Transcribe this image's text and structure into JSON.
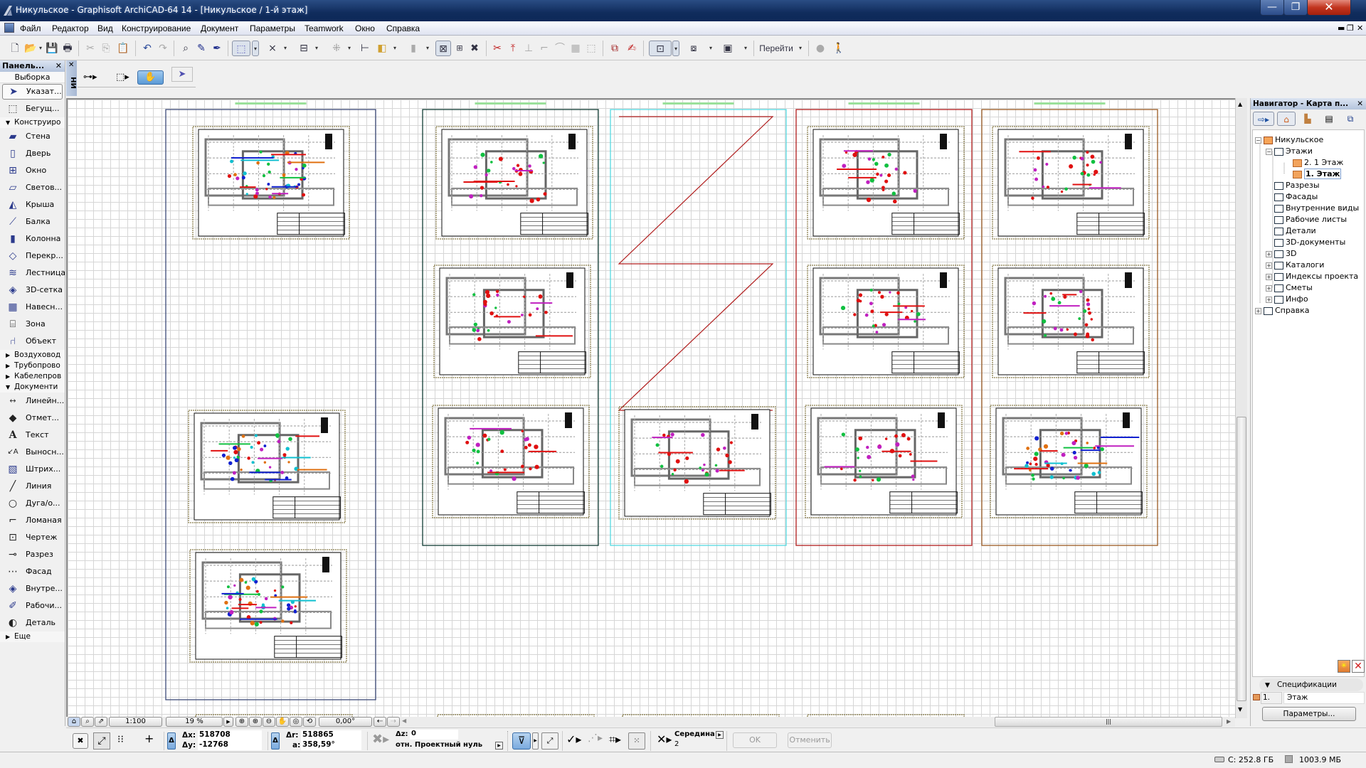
{
  "window": {
    "title": "Никульское - Graphisoft ArchiCAD-64 14 - [Никульское / 1-й этаж]",
    "controls": {
      "minimize": "—",
      "maximize": "❐",
      "close": "✕"
    }
  },
  "menubar": {
    "items": [
      "Файл",
      "Редактор",
      "Вид",
      "Конструирование",
      "Документ",
      "Параметры",
      "Teamwork",
      "Окно",
      "Справка"
    ],
    "mdi_controls": {
      "minimize": "▬",
      "restore": "❐",
      "close": "✕"
    }
  },
  "toolbar": {
    "goto_label": "Перейти",
    "icons": [
      "new-file",
      "open-file",
      "save",
      "print",
      "cut",
      "copy",
      "paste",
      "undo",
      "redo",
      "find-select",
      "eyedropper",
      "syringe",
      "marquee-select",
      "intersection",
      "element-info",
      "grid-snap",
      "ruler",
      "layers",
      "trace",
      "gravity",
      "dimension",
      "delete",
      "split",
      "adjust",
      "trim",
      "fillet",
      "curve",
      "group",
      "ungroup",
      "fit-in-window",
      "pen-set",
      "floorplan-view",
      "3d-view",
      "layout-view",
      "navigator",
      "walk"
    ]
  },
  "toolbox": {
    "title": "Панель...",
    "selection_label": "Выборка",
    "select_tools": [
      {
        "label": "Указат...",
        "icon": "arrow-pointer-icon",
        "active": true
      },
      {
        "label": "Бегущ...",
        "icon": "marquee-icon",
        "active": false
      }
    ],
    "groups": [
      {
        "label": "Конструиро",
        "expanded": true,
        "tools": [
          {
            "label": "Стена",
            "icon": "wall-icon"
          },
          {
            "label": "Дверь",
            "icon": "door-icon"
          },
          {
            "label": "Окно",
            "icon": "window-icon"
          },
          {
            "label": "Светов...",
            "icon": "skylight-icon"
          },
          {
            "label": "Крыша",
            "icon": "roof-icon"
          },
          {
            "label": "Балка",
            "icon": "beam-icon"
          },
          {
            "label": "Колонна",
            "icon": "column-icon"
          },
          {
            "label": "Перекр...",
            "icon": "slab-icon"
          },
          {
            "label": "Лестница",
            "icon": "stair-icon"
          },
          {
            "label": "3D-сетка",
            "icon": "mesh-icon"
          },
          {
            "label": "Навесн...",
            "icon": "curtain-wall-icon"
          },
          {
            "label": "Зона",
            "icon": "zone-icon"
          },
          {
            "label": "Объект",
            "icon": "object-icon"
          }
        ]
      },
      {
        "label": "Воздуховод",
        "expanded": false,
        "tools": []
      },
      {
        "label": "Трубопрово",
        "expanded": false,
        "tools": []
      },
      {
        "label": "Кабелепров",
        "expanded": false,
        "tools": []
      },
      {
        "label": "Документи",
        "expanded": true,
        "tools": [
          {
            "label": "Линейн...",
            "icon": "linear-dimension-icon"
          },
          {
            "label": "Отмет...",
            "icon": "level-dimension-icon"
          },
          {
            "label": "Текст",
            "icon": "text-icon"
          },
          {
            "label": "Выносн...",
            "icon": "label-icon"
          },
          {
            "label": "Штрих...",
            "icon": "fill-icon"
          },
          {
            "label": "Линия",
            "icon": "line-icon"
          },
          {
            "label": "Дуга/о...",
            "icon": "arc-circle-icon"
          },
          {
            "label": "Ломаная",
            "icon": "polyline-icon"
          },
          {
            "label": "Чертеж",
            "icon": "drawing-icon"
          },
          {
            "label": "Разрез",
            "icon": "section-icon"
          },
          {
            "label": "Фасад",
            "icon": "elevation-icon"
          },
          {
            "label": "Внутре...",
            "icon": "interior-elevation-icon"
          },
          {
            "label": "Рабочи...",
            "icon": "worksheet-icon"
          },
          {
            "label": "Деталь",
            "icon": "detail-icon"
          }
        ]
      },
      {
        "label": "Еще",
        "expanded": false,
        "tools": []
      }
    ]
  },
  "infobox": {
    "side_label": "ИН"
  },
  "canvas": {
    "frame_colors": {
      "col1": "#3d4a78",
      "col2": "#103c34",
      "col3": "#55d8e0",
      "col4": "#b01c1c",
      "col5": "#9a5a24",
      "zigzag": "#b01c1c"
    },
    "sheets_per_column": [
      [
        "plan",
        "empty",
        "plan-color",
        "plan-color"
      ],
      [
        "plan",
        "plan",
        "plan"
      ],
      [
        "zigzag",
        "plan"
      ],
      [
        "plan",
        "plan",
        "plan"
      ],
      [
        "plan",
        "plan",
        "plan"
      ]
    ]
  },
  "pagebar": {
    "scale": "1:100",
    "zoom": "19 %",
    "angle": "0,00°"
  },
  "coords": {
    "dx_label": "Δx:",
    "dx": "518708",
    "dy_label": "Δy:",
    "dy": "-12768",
    "dr_label": "Δr:",
    "dr": "518865",
    "a_label": "a:",
    "a": "358,59°",
    "dz_label": "Δz:",
    "dz": "0",
    "reference": "отн. Проектный нуль",
    "snap_label": "Середина",
    "snap_value": "2",
    "ok": "OK",
    "cancel": "Отменить"
  },
  "navigator": {
    "title": "Навигатор - Карта п...",
    "tree": [
      {
        "label": "Никульское",
        "level": 0,
        "toggle": "−",
        "icon": "house"
      },
      {
        "label": "Этажи",
        "level": 1,
        "toggle": "−",
        "icon": "stories"
      },
      {
        "label": "2. 1 Этаж",
        "level": 2,
        "toggle": "",
        "icon": "floor"
      },
      {
        "label": "1. Этаж",
        "level": 2,
        "toggle": "",
        "icon": "floor",
        "selected": true
      },
      {
        "label": "Разрезы",
        "level": 1,
        "toggle": "",
        "icon": "section"
      },
      {
        "label": "Фасады",
        "level": 1,
        "toggle": "",
        "icon": "elevation"
      },
      {
        "label": "Внутренние виды",
        "level": 1,
        "toggle": "",
        "icon": "interior"
      },
      {
        "label": "Рабочие листы",
        "level": 1,
        "toggle": "",
        "icon": "worksheet"
      },
      {
        "label": "Детали",
        "level": 1,
        "toggle": "",
        "icon": "detail"
      },
      {
        "label": "3D-документы",
        "level": 1,
        "toggle": "",
        "icon": "3d-doc"
      },
      {
        "label": "3D",
        "level": 1,
        "toggle": "+",
        "icon": "3d"
      },
      {
        "label": "Каталоги",
        "level": 1,
        "toggle": "+",
        "icon": "schedule"
      },
      {
        "label": "Индексы проекта",
        "level": 1,
        "toggle": "+",
        "icon": "index"
      },
      {
        "label": "Сметы",
        "level": 1,
        "toggle": "+",
        "icon": "list"
      },
      {
        "label": "Инфо",
        "level": 1,
        "toggle": "+",
        "icon": "info"
      },
      {
        "label": "Справка",
        "level": 0,
        "toggle": "+",
        "icon": "help"
      }
    ],
    "spec_header": "Спецификации",
    "spec_number": "1.",
    "spec_name": "Этаж",
    "params_button": "Параметры..."
  },
  "status": {
    "disk": "C: 252.8 ГБ",
    "memory": "1003.9 МБ"
  }
}
